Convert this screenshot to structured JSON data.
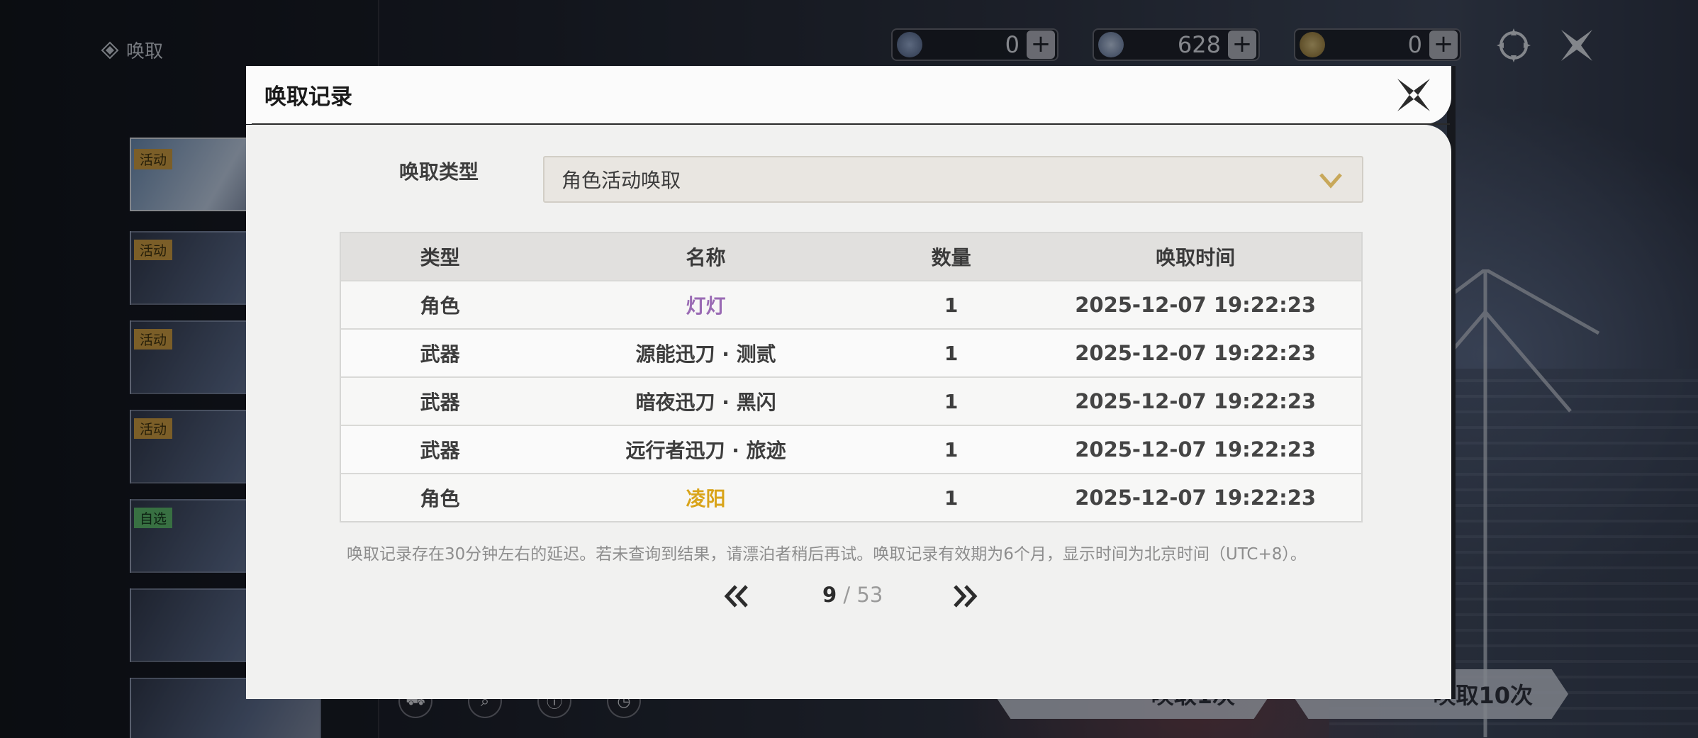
{
  "background": {
    "side_title": "唤取",
    "banner_tags": [
      "活动",
      "活动",
      "活动",
      "活动",
      "自选",
      "",
      ""
    ],
    "currencies": [
      {
        "icon": "astrite-coin-icon",
        "value": "0"
      },
      {
        "icon": "star-fragment-icon",
        "value": "628"
      },
      {
        "icon": "lustrous-tide-icon",
        "value": "0"
      }
    ],
    "pull_buttons": [
      "唤取1次",
      "唤取10次"
    ],
    "bottom_icons": [
      "shop-icon",
      "search-icon",
      "info-icon",
      "history-icon"
    ]
  },
  "modal": {
    "title": "唤取记录",
    "type_label": "唤取类型",
    "type_value": "角色活动唤取",
    "columns": [
      "类型",
      "名称",
      "数量",
      "唤取时间"
    ],
    "rows": [
      {
        "type": "角色",
        "name": "灯灯",
        "qty": "1",
        "time": "2025-12-07 19:22:23",
        "name_color": "#9a6bb4"
      },
      {
        "type": "武器",
        "name": "源能迅刀 · 测贰",
        "qty": "1",
        "time": "2025-12-07 19:22:23",
        "name_color": "#3d3d3d"
      },
      {
        "type": "武器",
        "name": "暗夜迅刀 · 黑闪",
        "qty": "1",
        "time": "2025-12-07 19:22:23",
        "name_color": "#3d3d3d"
      },
      {
        "type": "武器",
        "name": "远行者迅刀 · 旅迹",
        "qty": "1",
        "time": "2025-12-07 19:22:23",
        "name_color": "#3d3d3d"
      },
      {
        "type": "角色",
        "name": "凌阳",
        "qty": "1",
        "time": "2025-12-07 19:22:23",
        "name_color": "#d9a41a"
      }
    ],
    "note": "唤取记录存在30分钟左右的延迟。若未查询到结果，请漂泊者稍后再试。唤取记录有效期为6个月，显示时间为北京时间（UTC+8）。",
    "page_current": "9",
    "page_total": "53",
    "page_separator": " / "
  },
  "colors": {
    "accent_gold": "#c8a85a",
    "rare_purple": "#9a6bb4",
    "legendary_gold": "#d9a41a"
  }
}
